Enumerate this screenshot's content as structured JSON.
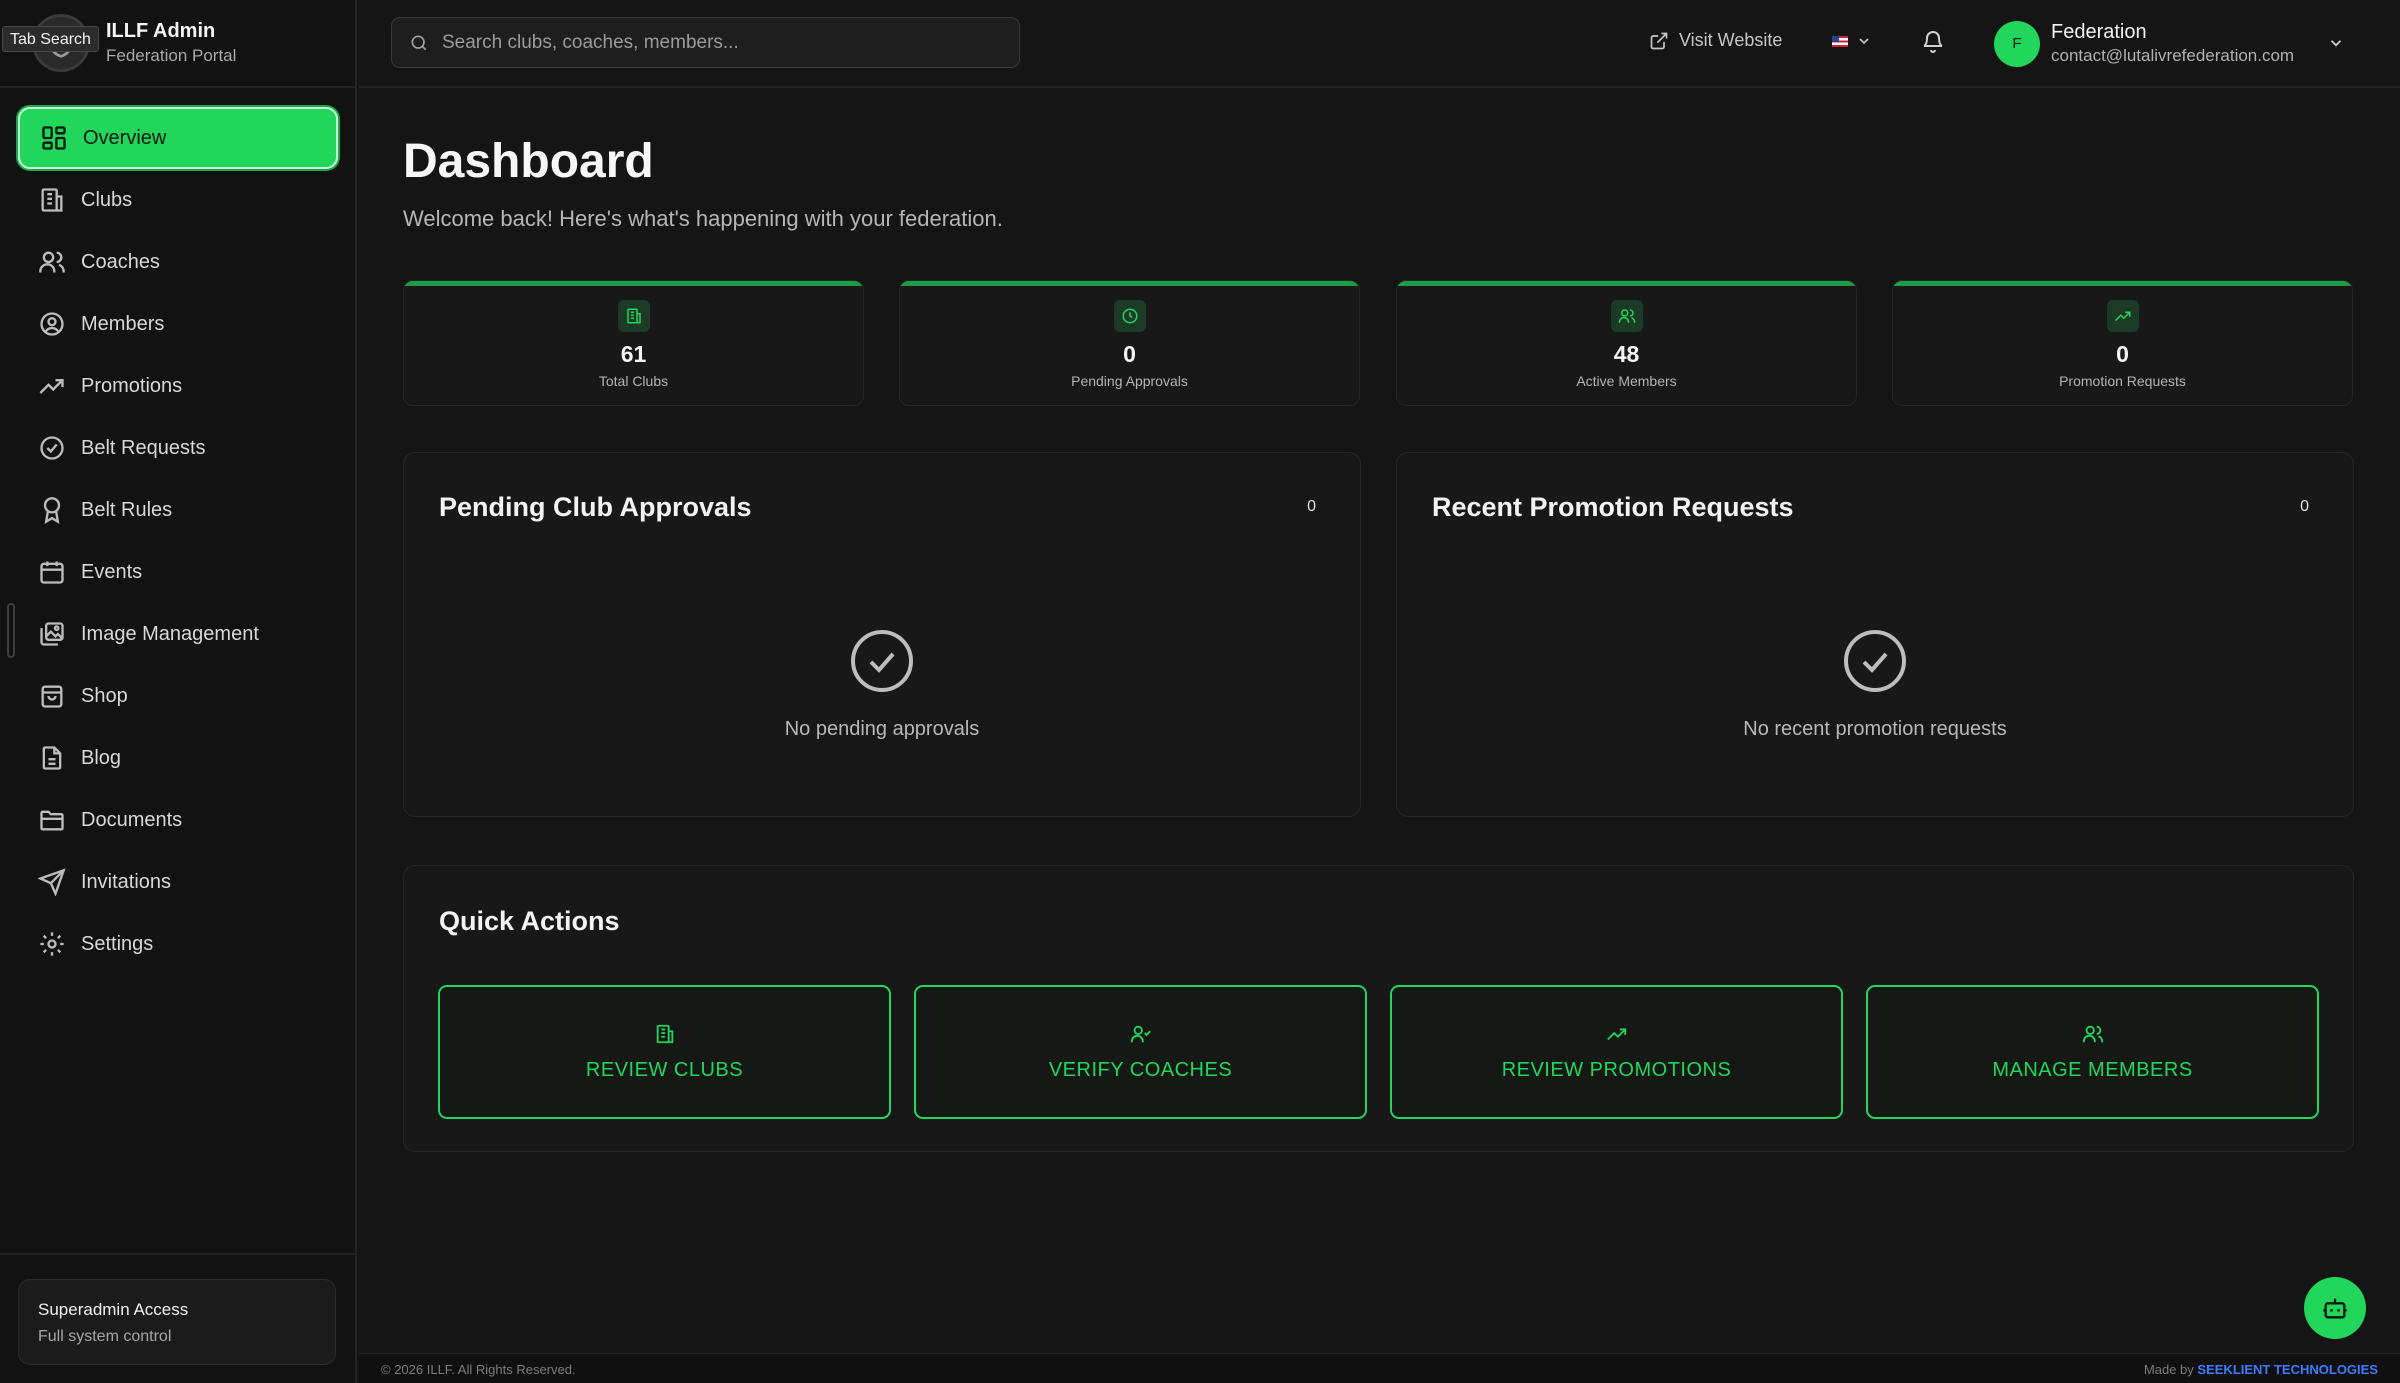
{
  "brand": {
    "title": "ILLF Admin",
    "subtitle": "Federation Portal",
    "tooltip": "Tab Search"
  },
  "sidebar": {
    "items": [
      {
        "label": "Overview",
        "icon": "grid-icon",
        "active": true
      },
      {
        "label": "Clubs",
        "icon": "building-icon"
      },
      {
        "label": "Coaches",
        "icon": "users-icon"
      },
      {
        "label": "Members",
        "icon": "user-circle-icon"
      },
      {
        "label": "Promotions",
        "icon": "trending-up-icon"
      },
      {
        "label": "Belt Requests",
        "icon": "check-circle-icon"
      },
      {
        "label": "Belt Rules",
        "icon": "award-icon"
      },
      {
        "label": "Events",
        "icon": "calendar-icon"
      },
      {
        "label": "Image Management",
        "icon": "images-icon"
      },
      {
        "label": "Shop",
        "icon": "shopping-bag-icon"
      },
      {
        "label": "Blog",
        "icon": "file-text-icon"
      },
      {
        "label": "Documents",
        "icon": "folder-icon"
      },
      {
        "label": "Invitations",
        "icon": "send-icon"
      },
      {
        "label": "Settings",
        "icon": "gear-icon"
      }
    ],
    "access": {
      "title": "Superadmin Access",
      "subtitle": "Full system control"
    }
  },
  "topbar": {
    "search_placeholder": "Search clubs, coaches, members...",
    "visit_label": "Visit Website",
    "user": {
      "initial": "F",
      "name": "Federation",
      "email": "contact@lutalivrefederation.com"
    }
  },
  "dashboard": {
    "title": "Dashboard",
    "subtitle": "Welcome back! Here's what's happening with your federation.",
    "stats": [
      {
        "value": "61",
        "label": "Total Clubs",
        "icon": "building-icon"
      },
      {
        "value": "0",
        "label": "Pending Approvals",
        "icon": "clock-icon"
      },
      {
        "value": "48",
        "label": "Active Members",
        "icon": "users-icon"
      },
      {
        "value": "0",
        "label": "Promotion Requests",
        "icon": "trending-up-icon"
      }
    ],
    "pending": {
      "title": "Pending Club Approvals",
      "count": "0",
      "empty": "No pending approvals"
    },
    "promotions": {
      "title": "Recent Promotion Requests",
      "count": "0",
      "empty": "No recent promotion requests"
    },
    "quick_actions": {
      "title": "Quick Actions",
      "buttons": [
        {
          "label": "REVIEW CLUBS",
          "icon": "building-icon"
        },
        {
          "label": "VERIFY COACHES",
          "icon": "user-check-icon"
        },
        {
          "label": "REVIEW PROMOTIONS",
          "icon": "trending-up-icon"
        },
        {
          "label": "MANAGE MEMBERS",
          "icon": "users-icon"
        }
      ]
    }
  },
  "footer": {
    "copyright": "© 2026 ILLF. All Rights Reserved.",
    "made_by_prefix": "Made by",
    "made_by_name": "SEEKLIENT TECHNOLOGIES"
  },
  "colors": {
    "accent": "#22d65b",
    "background": "#151515",
    "link": "#3b7bff"
  }
}
